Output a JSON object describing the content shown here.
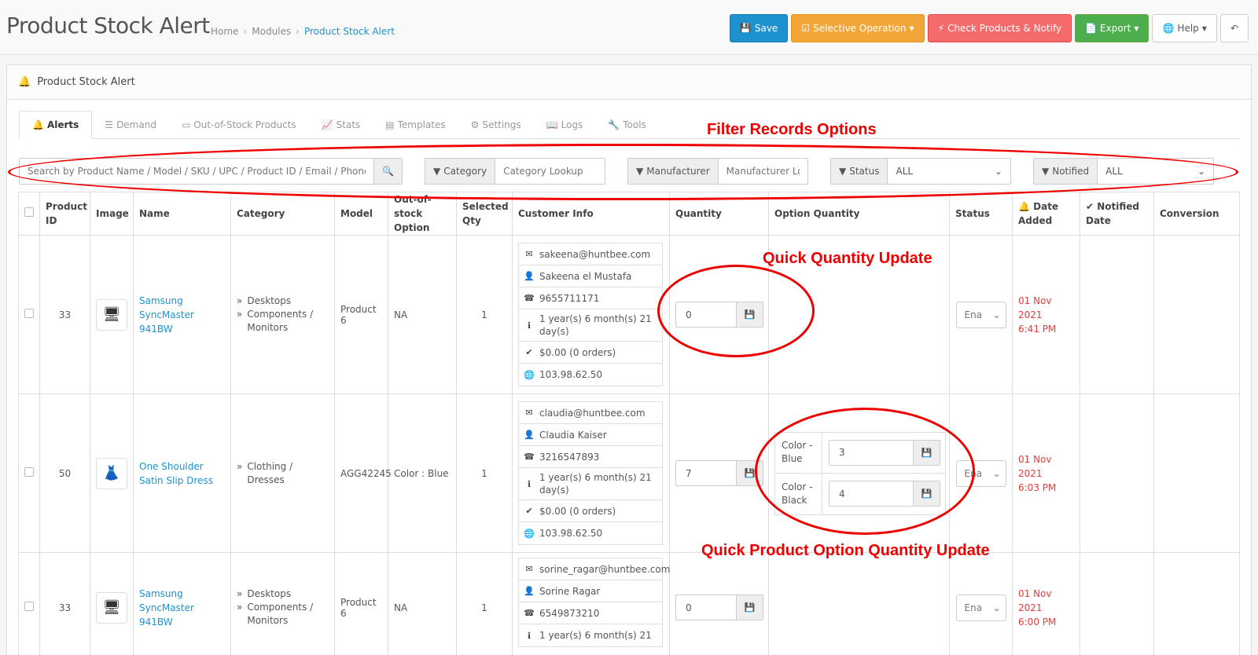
{
  "header": {
    "title": "Product Stock Alert",
    "breadcrumb": [
      "Home",
      "Modules",
      "Product Stock Alert"
    ],
    "buttons": {
      "save": "Save",
      "selective": "Selective Operation",
      "check": "Check Products & Notify",
      "export": "Export",
      "help": "Help"
    }
  },
  "panel": {
    "title": "Product Stock Alert"
  },
  "tabs": [
    "Alerts",
    "Demand",
    "Out-of-Stock Products",
    "Stats",
    "Templates",
    "Settings",
    "Logs",
    "Tools"
  ],
  "filters": {
    "search_placeholder": "Search by Product Name / Model / SKU / UPC / Product ID / Email / Phone / Customer",
    "category_label": "Category",
    "category_placeholder": "Category Lookup",
    "manufacturer_label": "Manufacturer",
    "manufacturer_placeholder": "Manufacturer Lookup",
    "status_label": "Status",
    "status_value": "ALL",
    "notified_label": "Notified",
    "notified_value": "ALL"
  },
  "columns": {
    "product_id": "Product ID",
    "image": "Image",
    "name": "Name",
    "category": "Category",
    "model": "Model",
    "oos_option": "Out-of-stock Option",
    "selected_qty": "Selected Qty",
    "customer_info": "Customer Info",
    "quantity": "Quantity",
    "option_quantity": "Option Quantity",
    "status": "Status",
    "date_added": "Date Added",
    "notified_date": "Notified Date",
    "conversion": "Conversion"
  },
  "rows": [
    {
      "product_id": "33",
      "name": "Samsung SyncMaster 941BW",
      "category": [
        "Desktops",
        "Components / Monitors"
      ],
      "model": "Product 6",
      "oos_option": "NA",
      "selected_qty": "1",
      "email": "sakeena@huntbee.com",
      "customer": "Sakeena el Mustafa",
      "phone": "9655711171",
      "age": "1 year(s) 6 month(s) 21 day(s)",
      "spent": "$0.00 (0 orders)",
      "ip": "103.98.62.50",
      "quantity": "0",
      "status": "Ena",
      "date": "01 Nov 2021",
      "time": "6:41 PM"
    },
    {
      "product_id": "50",
      "name": "One Shoulder Satin Slip Dress",
      "category": [
        "Clothing / Dresses"
      ],
      "model": "AGG42245",
      "oos_option": "Color : Blue",
      "selected_qty": "1",
      "email": "claudia@huntbee.com",
      "customer": "Claudia Kaiser",
      "phone": "3216547893",
      "age": "1 year(s) 6 month(s) 21 day(s)",
      "spent": "$0.00 (0 orders)",
      "ip": "103.98.62.50",
      "quantity": "7",
      "options": [
        {
          "label": "Color - Blue",
          "qty": "3"
        },
        {
          "label": "Color - Black",
          "qty": "4"
        }
      ],
      "status": "Ena",
      "date": "01 Nov 2021",
      "time": "6:03 PM"
    },
    {
      "product_id": "33",
      "name": "Samsung SyncMaster 941BW",
      "category": [
        "Desktops",
        "Components / Monitors"
      ],
      "model": "Product 6",
      "oos_option": "NA",
      "selected_qty": "1",
      "email": "sorine_ragar@huntbee.com",
      "customer": "Sorine Ragar",
      "phone": "6549873210",
      "age": "1 year(s) 6 month(s) 21",
      "quantity": "0",
      "status": "Ena",
      "date": "01 Nov 2021",
      "time": "6:00 PM"
    }
  ],
  "annotations": {
    "filter": "Filter Records Options",
    "quantity": "Quick Quantity Update",
    "option_quantity": "Quick Product Option Quantity Update"
  },
  "colors": {
    "primary": "#1e91cf",
    "warning": "#f3a638",
    "danger": "#f56b6b",
    "success": "#4cae4c",
    "annotation": "#ee0000"
  }
}
